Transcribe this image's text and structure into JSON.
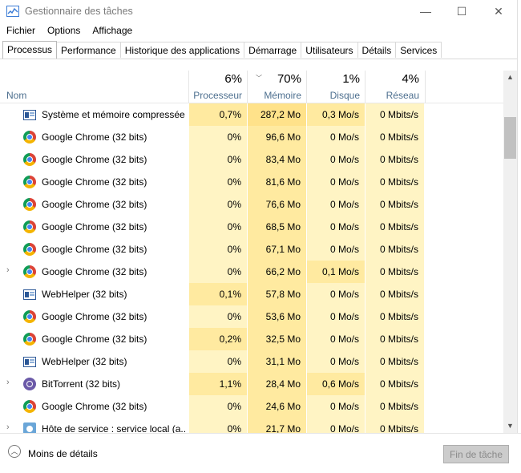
{
  "window": {
    "title": "Gestionnaire des tâches",
    "minimize": "—",
    "maximize": "☐",
    "close": "✕"
  },
  "menu": [
    "Fichier",
    "Options",
    "Affichage"
  ],
  "tabs": [
    "Processus",
    "Performance",
    "Historique des applications",
    "Démarrage",
    "Utilisateurs",
    "Détails",
    "Services"
  ],
  "active_tab": "Processus",
  "columns": {
    "name": "Nom",
    "cpu": {
      "pct": "6%",
      "label": "Processeur"
    },
    "mem": {
      "pct": "70%",
      "label": "Mémoire"
    },
    "disk": {
      "pct": "1%",
      "label": "Disque"
    },
    "net": {
      "pct": "4%",
      "label": "Réseau"
    }
  },
  "colors": {
    "cell_light": "#fff4c4",
    "cell_mid": "#ffeaa0",
    "cell_strong": "#ffe28a",
    "header_label": "#4d6f8f"
  },
  "processes": [
    {
      "name": "Système et mémoire compressée",
      "icon": "system-icon",
      "expand": "",
      "cpu": "0,7%",
      "mem": "287,2 Mo",
      "disk": "0,3 Mo/s",
      "net": "0 Mbits/s"
    },
    {
      "name": "Google Chrome (32 bits)",
      "icon": "chrome-icon",
      "expand": "",
      "cpu": "0%",
      "mem": "96,6 Mo",
      "disk": "0 Mo/s",
      "net": "0 Mbits/s"
    },
    {
      "name": "Google Chrome (32 bits)",
      "icon": "chrome-icon",
      "expand": "",
      "cpu": "0%",
      "mem": "83,4 Mo",
      "disk": "0 Mo/s",
      "net": "0 Mbits/s"
    },
    {
      "name": "Google Chrome (32 bits)",
      "icon": "chrome-icon",
      "expand": "",
      "cpu": "0%",
      "mem": "81,6 Mo",
      "disk": "0 Mo/s",
      "net": "0 Mbits/s"
    },
    {
      "name": "Google Chrome (32 bits)",
      "icon": "chrome-icon",
      "expand": "",
      "cpu": "0%",
      "mem": "76,6 Mo",
      "disk": "0 Mo/s",
      "net": "0 Mbits/s"
    },
    {
      "name": "Google Chrome (32 bits)",
      "icon": "chrome-icon",
      "expand": "",
      "cpu": "0%",
      "mem": "68,5 Mo",
      "disk": "0 Mo/s",
      "net": "0 Mbits/s"
    },
    {
      "name": "Google Chrome (32 bits)",
      "icon": "chrome-icon",
      "expand": "",
      "cpu": "0%",
      "mem": "67,1 Mo",
      "disk": "0 Mo/s",
      "net": "0 Mbits/s"
    },
    {
      "name": "Google Chrome (32 bits)",
      "icon": "chrome-icon",
      "expand": "›",
      "cpu": "0%",
      "mem": "66,2 Mo",
      "disk": "0,1 Mo/s",
      "net": "0 Mbits/s"
    },
    {
      "name": "WebHelper (32 bits)",
      "icon": "app-window-icon",
      "expand": "",
      "cpu": "0,1%",
      "mem": "57,8 Mo",
      "disk": "0 Mo/s",
      "net": "0 Mbits/s"
    },
    {
      "name": "Google Chrome (32 bits)",
      "icon": "chrome-icon",
      "expand": "",
      "cpu": "0%",
      "mem": "53,6 Mo",
      "disk": "0 Mo/s",
      "net": "0 Mbits/s"
    },
    {
      "name": "Google Chrome (32 bits)",
      "icon": "chrome-icon",
      "expand": "",
      "cpu": "0,2%",
      "mem": "32,5 Mo",
      "disk": "0 Mo/s",
      "net": "0 Mbits/s"
    },
    {
      "name": "WebHelper (32 bits)",
      "icon": "app-window-icon",
      "expand": "",
      "cpu": "0%",
      "mem": "31,1 Mo",
      "disk": "0 Mo/s",
      "net": "0 Mbits/s"
    },
    {
      "name": "BitTorrent (32 bits)",
      "icon": "bittorrent-icon",
      "expand": "›",
      "cpu": "1,1%",
      "mem": "28,4 Mo",
      "disk": "0,6 Mo/s",
      "net": "0 Mbits/s"
    },
    {
      "name": "Google Chrome (32 bits)",
      "icon": "chrome-icon",
      "expand": "",
      "cpu": "0%",
      "mem": "24,6 Mo",
      "disk": "0 Mo/s",
      "net": "0 Mbits/s"
    },
    {
      "name": "Hôte de service : service local (a...",
      "icon": "service-host-icon",
      "expand": "›",
      "cpu": "0%",
      "mem": "21,7 Mo",
      "disk": "0 Mo/s",
      "net": "0 Mbits/s"
    }
  ],
  "footer": {
    "fewer_details": "Moins de détails",
    "end_task": "Fin de tâche"
  }
}
